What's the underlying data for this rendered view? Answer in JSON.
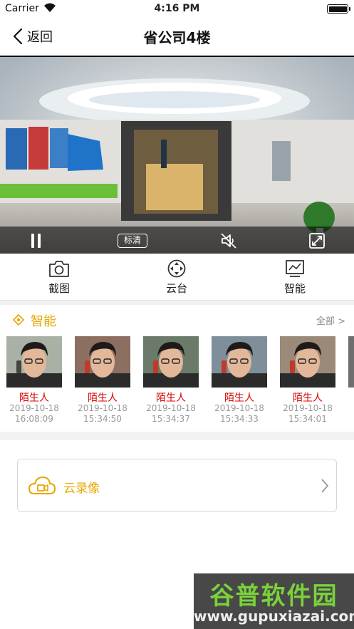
{
  "status_bar": {
    "carrier": "Carrier",
    "time": "4:16 PM"
  },
  "nav": {
    "back_label": "返回",
    "title": "省公司4楼"
  },
  "video": {
    "quality_label": "标清"
  },
  "toolbar": {
    "snapshot_label": "截图",
    "ptz_label": "云台",
    "smart_label": "智能"
  },
  "smart": {
    "title": "智能",
    "more_label": "全部 >",
    "records": [
      {
        "label": "陌生人",
        "date": "2019-10-18",
        "time": "16:08:09"
      },
      {
        "label": "陌生人",
        "date": "2019-10-18",
        "time": "15:34:50"
      },
      {
        "label": "陌生人",
        "date": "2019-10-18",
        "time": "15:34:37"
      },
      {
        "label": "陌生人",
        "date": "2019-10-18",
        "time": "15:34:33"
      },
      {
        "label": "陌生人",
        "date": "2019-10-18",
        "time": "15:34:01"
      }
    ]
  },
  "cloud": {
    "label": "云录像"
  },
  "watermark": {
    "title": "谷普软件园",
    "url": "www.gupuxiazai.com"
  },
  "colors": {
    "accent": "#e6a700",
    "stranger": "#d80000"
  }
}
